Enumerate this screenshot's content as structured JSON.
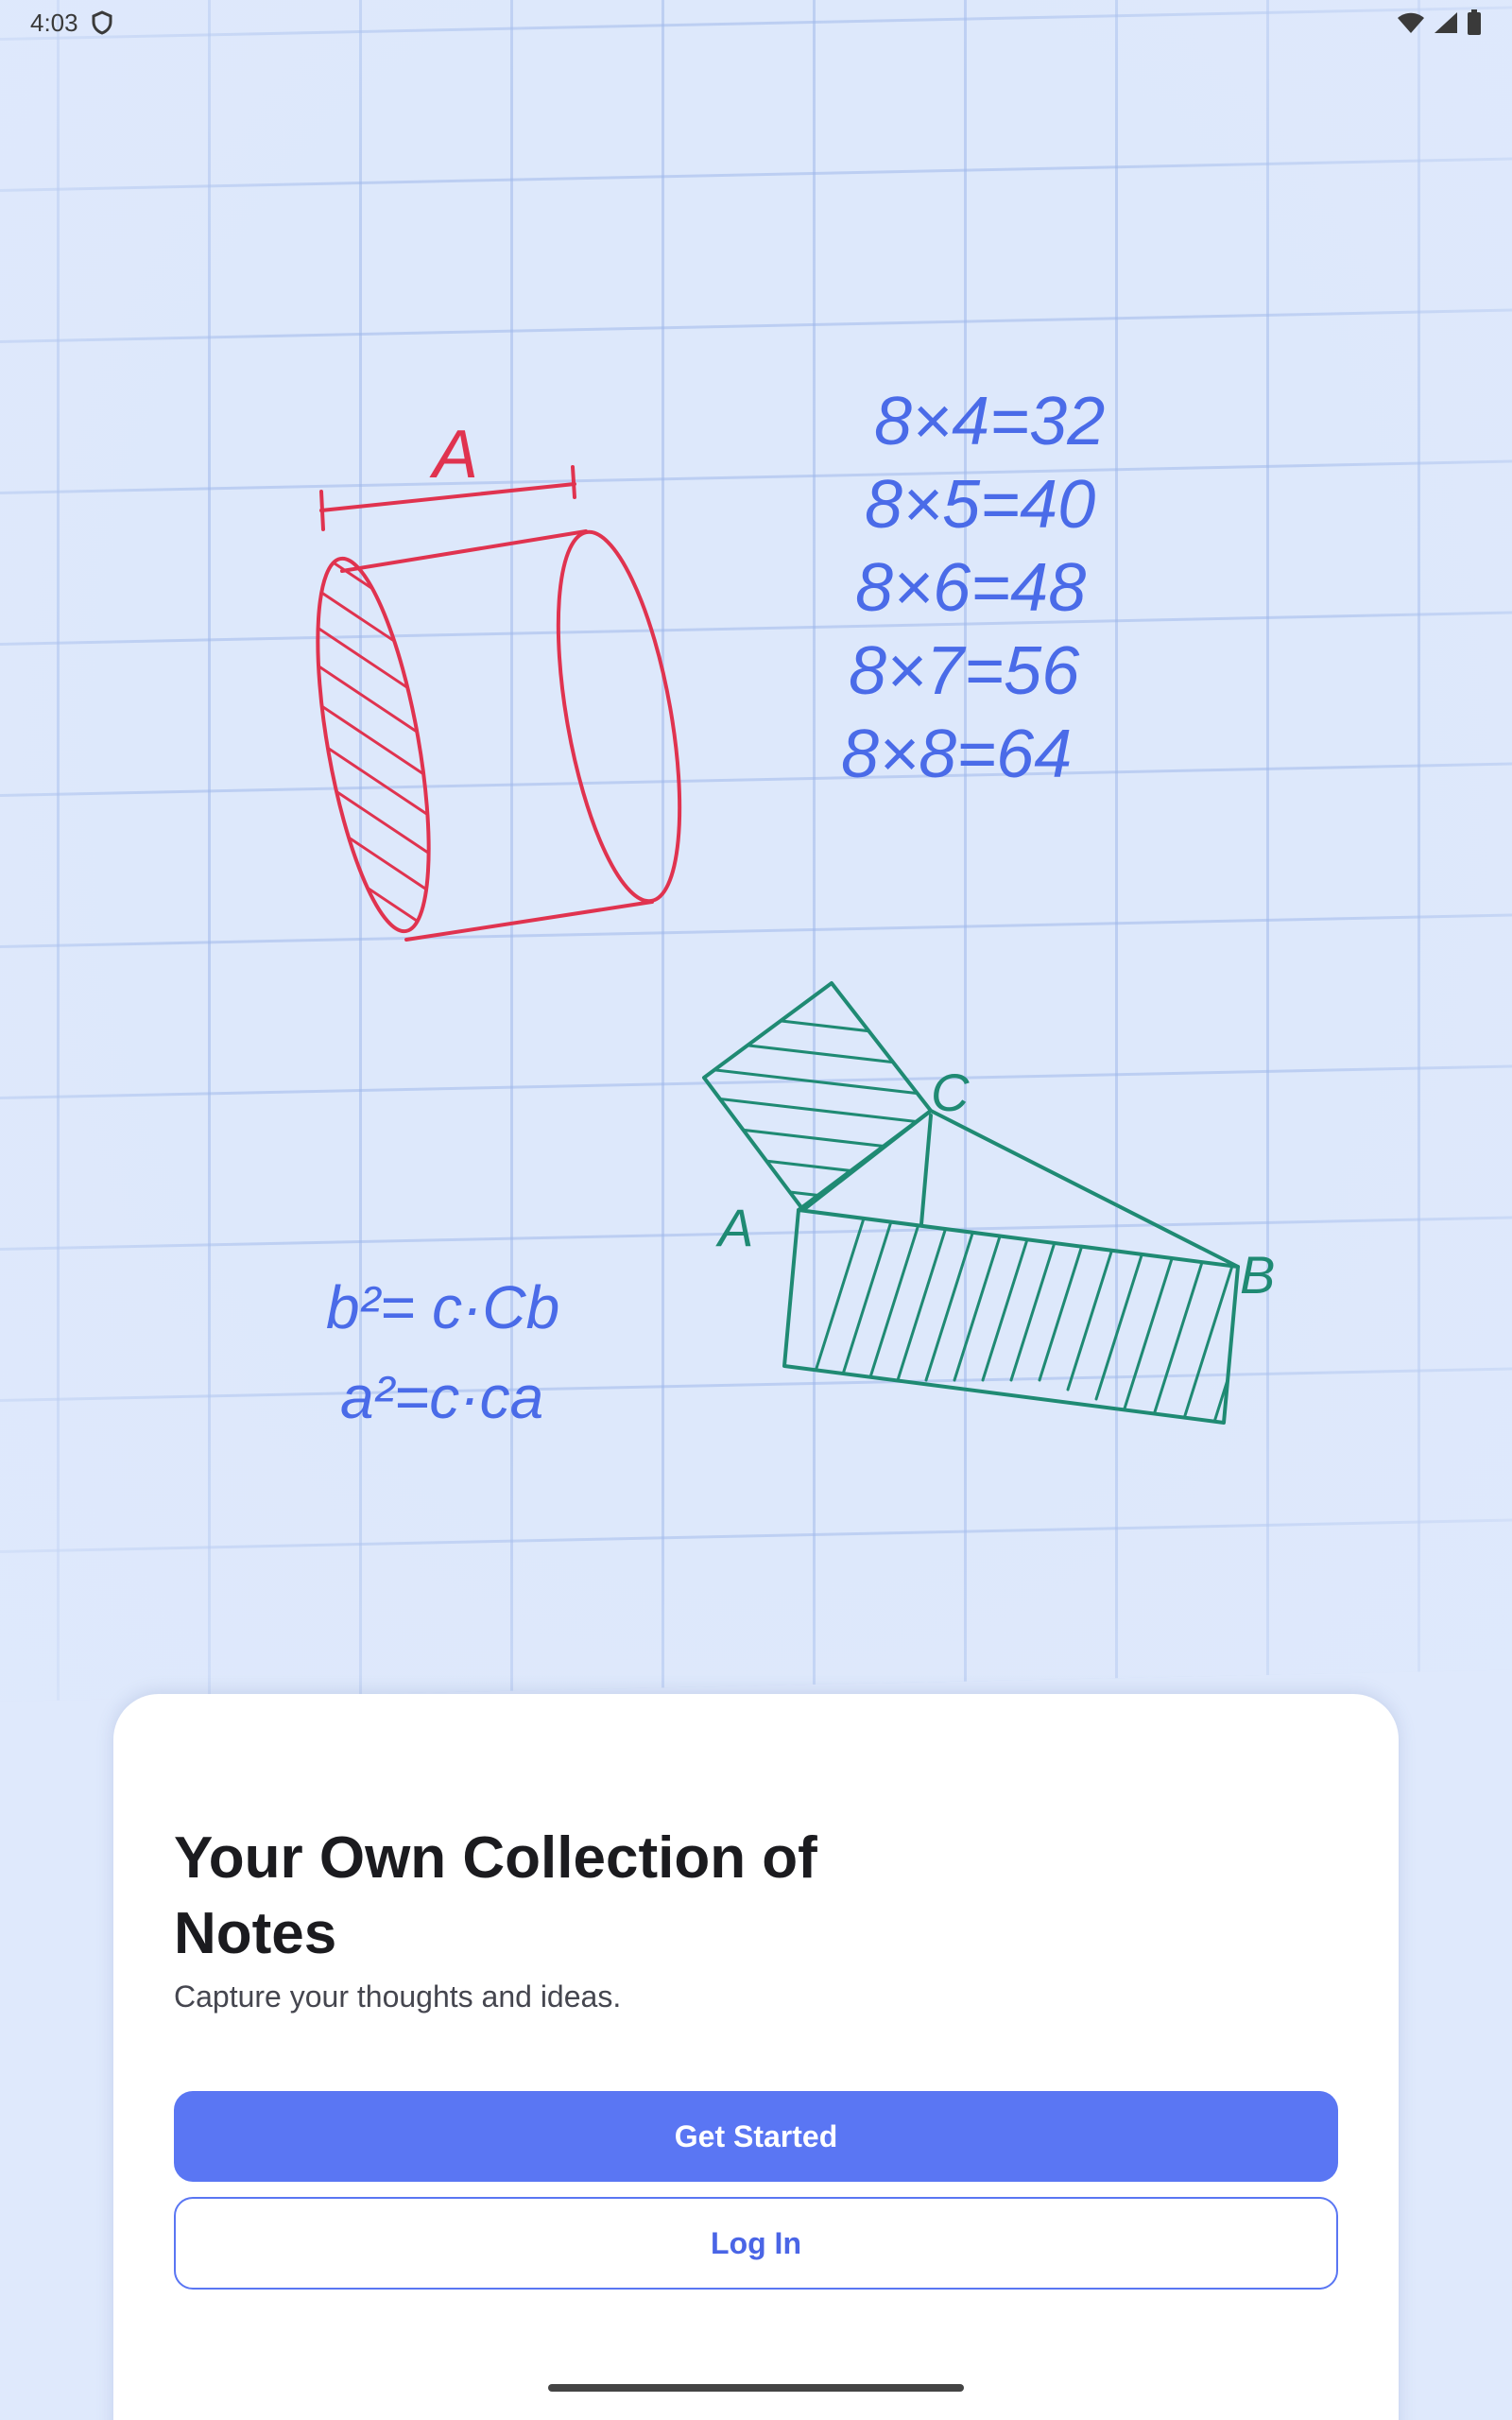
{
  "status_bar": {
    "time": "4:03",
    "icons": [
      "shield-icon",
      "wifi-icon",
      "signal-icon",
      "battery-icon"
    ]
  },
  "illustration": {
    "cylinder_label": "A",
    "multiplication": [
      "8×4=32",
      "8×5=40",
      "8×6=48",
      "8×7=56",
      "8×8=64"
    ],
    "formula_1": "b²= c·Cb",
    "formula_2": "a²=c·ca",
    "triangle_labels": {
      "a": "A",
      "b": "B",
      "c": "C"
    },
    "colors": {
      "red": "#e0334f",
      "blue": "#4a6be8",
      "green": "#1f8a73"
    }
  },
  "onboarding": {
    "title": "Your Own Collection of Notes",
    "subtitle": "Capture your thoughts and ideas.",
    "primary_button": "Get Started",
    "secondary_button": "Log In"
  },
  "theme": {
    "accent": "#5a76f3",
    "background": "#dfe9fc"
  }
}
